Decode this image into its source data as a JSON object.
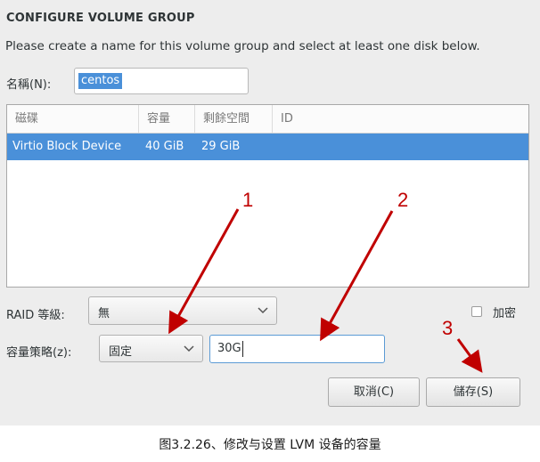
{
  "dialog": {
    "title": "CONFIGURE VOLUME GROUP",
    "instruction": "Please create a name for this volume group and select at least one disk below.",
    "name_label": "名稱(N):",
    "name_value": "centos"
  },
  "disk_table": {
    "columns": [
      "磁碟",
      "容量",
      "剩餘空間",
      "ID"
    ],
    "rows": [
      {
        "disk": "Virtio Block Device",
        "capacity": "40 GiB",
        "free": "29 GiB",
        "id": ""
      }
    ]
  },
  "raid": {
    "label": "RAID 等級:",
    "value": "無"
  },
  "encrypt": {
    "label": "加密",
    "checked": false
  },
  "size_policy": {
    "label": "容量策略(z):",
    "value": "固定",
    "size_value": "30G"
  },
  "buttons": {
    "cancel": "取消(C)",
    "save": "儲存(S)"
  },
  "annotations": {
    "n1": "1",
    "n2": "2",
    "n3": "3"
  },
  "caption": "图3.2.26、修改与设置 LVM 设备的容量",
  "colors": {
    "selection": "#4a90d9",
    "annotation": "#c00000",
    "dialog_bg": "#ededed"
  }
}
